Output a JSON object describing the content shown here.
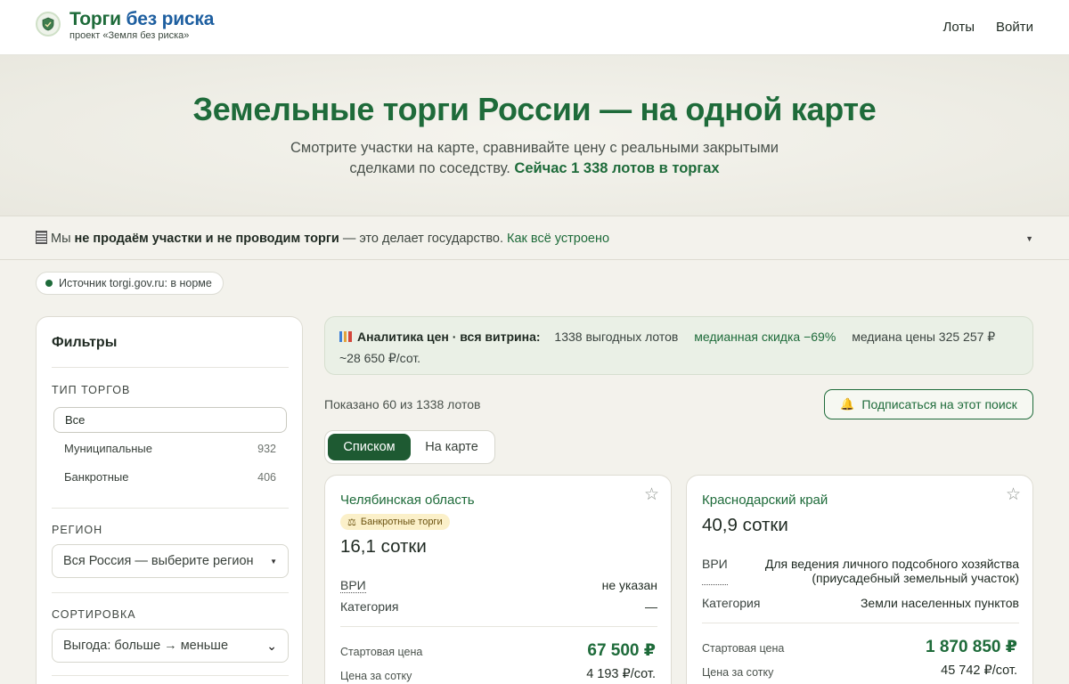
{
  "header": {
    "brand_part1": "Торги",
    "brand_part2": "без риска",
    "brand_sub": "проект «Земля без риска»",
    "nav": [
      "Лоты",
      "Войти"
    ]
  },
  "hero": {
    "title": "Земельные торги России — на одной карте",
    "desc_line1": "Смотрите участки на карте, сравнивайте цену с реальными закрытыми",
    "desc_line2": "сделками по соседству.",
    "desc_bold": "Сейчас 1 338 лотов в торгах"
  },
  "notice": {
    "icon": "document-icon",
    "part1": "Мы",
    "bold": "не продаём участки и не проводим торги",
    "part2": "— это делает государство.",
    "link": "Как всё устроено"
  },
  "source": {
    "label": "Источник torgi.gov.ru: в норме",
    "status_color": "#1e6b3a"
  },
  "filters": {
    "title": "Фильтры",
    "trade_type_label": "ТИП ТОРГОВ",
    "options": [
      {
        "label": "Все",
        "count": ""
      },
      {
        "label": "Муниципальные",
        "count": "932"
      },
      {
        "label": "Банкротные",
        "count": "406"
      }
    ],
    "region_label": "РЕГИОН",
    "region_value": "Вся Россия — выберите регион",
    "sort_label": "СОРТИРОВКА",
    "sort_value": "Выгода: больше → меньше"
  },
  "analytics": {
    "title": "Аналитика цен · вся витрина:",
    "lots": "1338 выгодных лотов",
    "discount": "медианная скидка −69%",
    "median": "медиана цены 325 257 ₽",
    "per_sotka": "~28 650 ₽/сот."
  },
  "listing": {
    "shown": "Показано 60 из 1338 лотов",
    "subscribe": "Подписаться на этот поиск",
    "view_list": "Списком",
    "view_map": "На карте"
  },
  "cards": [
    {
      "region": "Челябинская область",
      "badge": "Банкротные торги",
      "area": "16,1 сотки",
      "vri_label": "ВРИ",
      "vri_value": "не указан",
      "category_label": "Категория",
      "category_value": "—",
      "start_price_label": "Стартовая цена",
      "start_price": "67 500 ₽",
      "pps_label": "Цена за сотку",
      "pps": "4 193 ₽/сот."
    },
    {
      "region": "Краснодарский край",
      "area": "40,9 сотки",
      "vri_label": "ВРИ",
      "vri_value_1": "Для ведения личного подсобного хозяйства",
      "vri_value_2": "(приусадебный земельный участок)",
      "category_label": "Категория",
      "category_value": "Земли населенных пунктов",
      "start_price_label": "Стартовая цена",
      "start_price": "1 870 850 ₽",
      "pps_label": "Цена за сотку",
      "pps": "45 742 ₽/сот."
    }
  ]
}
